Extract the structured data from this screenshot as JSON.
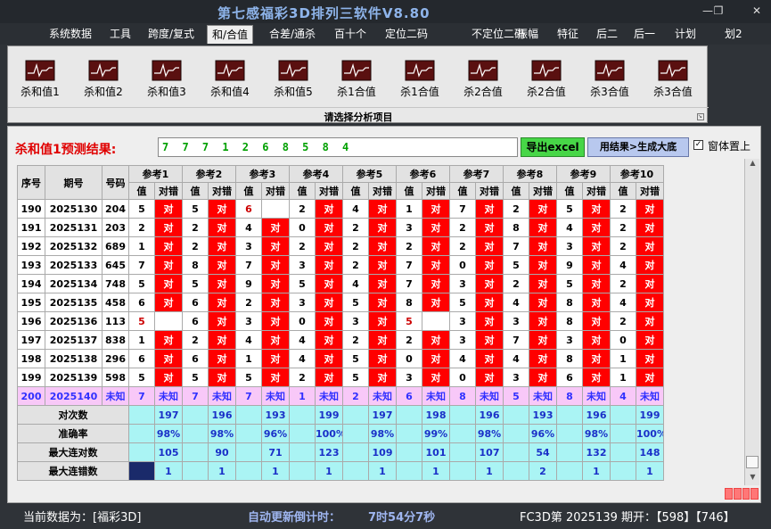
{
  "app": {
    "title": "第七感福彩3D排列三软件V8.80"
  },
  "menu": [
    "系统数据",
    "工具",
    "跨度/复式",
    "和/合值",
    "合差/通杀",
    "百十个",
    "定位二码",
    "不定位二码",
    "振幅",
    "特征",
    "后二",
    "后一",
    "计划",
    "划2"
  ],
  "menu_active": 3,
  "ribbon": {
    "buttons": [
      "杀和值1",
      "杀和值2",
      "杀和值3",
      "杀和值4",
      "杀和值5",
      "杀1合值",
      "杀1合值",
      "杀2合值",
      "杀2合值",
      "杀3合值",
      "杀3合值"
    ],
    "icon": "chart-icon",
    "caption": "请选择分析项目"
  },
  "prediction": {
    "label": "杀和值1预测结果:",
    "values": "7 7 7 1 2 6 8 5 8 4"
  },
  "buttons": {
    "export": "导出excel",
    "generate": "用结果>生成大底"
  },
  "checkbox": {
    "label": "窗体置上",
    "checked": "✓"
  },
  "table": {
    "headers": {
      "seq": "序号",
      "period": "期号",
      "number": "号码",
      "val": "值",
      "result": "对错"
    },
    "refs": [
      "参考1",
      "参考2",
      "参考3",
      "参考4",
      "参考5",
      "参考6",
      "参考7",
      "参考8",
      "参考9",
      "参考10"
    ],
    "rows": [
      {
        "seq": "190",
        "period": "2025130",
        "number": "204",
        "cells": [
          [
            "5",
            "对"
          ],
          [
            "5",
            "对"
          ],
          [
            "6",
            ""
          ],
          [
            "2",
            "对"
          ],
          [
            "4",
            "对"
          ],
          [
            "1",
            "对"
          ],
          [
            "7",
            "对"
          ],
          [
            "2",
            "对"
          ],
          [
            "5",
            "对"
          ],
          [
            "2",
            "对"
          ]
        ]
      },
      {
        "seq": "191",
        "period": "2025131",
        "number": "203",
        "cells": [
          [
            "2",
            "对"
          ],
          [
            "2",
            "对"
          ],
          [
            "4",
            "对"
          ],
          [
            "0",
            "对"
          ],
          [
            "2",
            "对"
          ],
          [
            "3",
            "对"
          ],
          [
            "2",
            "对"
          ],
          [
            "8",
            "对"
          ],
          [
            "4",
            "对"
          ],
          [
            "2",
            "对"
          ]
        ]
      },
      {
        "seq": "192",
        "period": "2025132",
        "number": "689",
        "cells": [
          [
            "1",
            "对"
          ],
          [
            "2",
            "对"
          ],
          [
            "3",
            "对"
          ],
          [
            "2",
            "对"
          ],
          [
            "2",
            "对"
          ],
          [
            "2",
            "对"
          ],
          [
            "2",
            "对"
          ],
          [
            "7",
            "对"
          ],
          [
            "3",
            "对"
          ],
          [
            "2",
            "对"
          ]
        ]
      },
      {
        "seq": "193",
        "period": "2025133",
        "number": "645",
        "cells": [
          [
            "7",
            "对"
          ],
          [
            "8",
            "对"
          ],
          [
            "7",
            "对"
          ],
          [
            "3",
            "对"
          ],
          [
            "2",
            "对"
          ],
          [
            "7",
            "对"
          ],
          [
            "0",
            "对"
          ],
          [
            "5",
            "对"
          ],
          [
            "9",
            "对"
          ],
          [
            "4",
            "对"
          ]
        ]
      },
      {
        "seq": "194",
        "period": "2025134",
        "number": "748",
        "cells": [
          [
            "5",
            "对"
          ],
          [
            "5",
            "对"
          ],
          [
            "9",
            "对"
          ],
          [
            "5",
            "对"
          ],
          [
            "4",
            "对"
          ],
          [
            "7",
            "对"
          ],
          [
            "3",
            "对"
          ],
          [
            "2",
            "对"
          ],
          [
            "5",
            "对"
          ],
          [
            "2",
            "对"
          ]
        ]
      },
      {
        "seq": "195",
        "period": "2025135",
        "number": "458",
        "cells": [
          [
            "6",
            "对"
          ],
          [
            "6",
            "对"
          ],
          [
            "2",
            "对"
          ],
          [
            "3",
            "对"
          ],
          [
            "5",
            "对"
          ],
          [
            "8",
            "对"
          ],
          [
            "5",
            "对"
          ],
          [
            "4",
            "对"
          ],
          [
            "8",
            "对"
          ],
          [
            "4",
            "对"
          ]
        ]
      },
      {
        "seq": "196",
        "period": "2025136",
        "number": "113",
        "cells": [
          [
            "5",
            ""
          ],
          [
            "6",
            "对"
          ],
          [
            "3",
            "对"
          ],
          [
            "0",
            "对"
          ],
          [
            "3",
            "对"
          ],
          [
            "5",
            ""
          ],
          [
            "3",
            "对"
          ],
          [
            "3",
            "对"
          ],
          [
            "8",
            "对"
          ],
          [
            "2",
            "对"
          ]
        ]
      },
      {
        "seq": "197",
        "period": "2025137",
        "number": "838",
        "cells": [
          [
            "1",
            "对"
          ],
          [
            "2",
            "对"
          ],
          [
            "4",
            "对"
          ],
          [
            "4",
            "对"
          ],
          [
            "2",
            "对"
          ],
          [
            "2",
            "对"
          ],
          [
            "3",
            "对"
          ],
          [
            "7",
            "对"
          ],
          [
            "3",
            "对"
          ],
          [
            "0",
            "对"
          ]
        ]
      },
      {
        "seq": "198",
        "period": "2025138",
        "number": "296",
        "cells": [
          [
            "6",
            "对"
          ],
          [
            "6",
            "对"
          ],
          [
            "1",
            "对"
          ],
          [
            "4",
            "对"
          ],
          [
            "5",
            "对"
          ],
          [
            "0",
            "对"
          ],
          [
            "4",
            "对"
          ],
          [
            "4",
            "对"
          ],
          [
            "8",
            "对"
          ],
          [
            "1",
            "对"
          ]
        ]
      },
      {
        "seq": "199",
        "period": "2025139",
        "number": "598",
        "cells": [
          [
            "5",
            "对"
          ],
          [
            "5",
            "对"
          ],
          [
            "5",
            "对"
          ],
          [
            "2",
            "对"
          ],
          [
            "5",
            "对"
          ],
          [
            "3",
            "对"
          ],
          [
            "0",
            "对"
          ],
          [
            "3",
            "对"
          ],
          [
            "6",
            "对"
          ],
          [
            "1",
            "对"
          ]
        ]
      },
      {
        "seq": "200",
        "period": "2025140",
        "number": "未知",
        "cells": [
          [
            "7",
            "未知"
          ],
          [
            "7",
            "未知"
          ],
          [
            "7",
            "未知"
          ],
          [
            "1",
            "未知"
          ],
          [
            "2",
            "未知"
          ],
          [
            "6",
            "未知"
          ],
          [
            "8",
            "未知"
          ],
          [
            "5",
            "未知"
          ],
          [
            "8",
            "未知"
          ],
          [
            "4",
            "未知"
          ]
        ]
      }
    ],
    "stats": [
      {
        "label": "对次数",
        "values": [
          "197",
          "196",
          "193",
          "199",
          "197",
          "198",
          "196",
          "193",
          "196",
          "199"
        ]
      },
      {
        "label": "准确率",
        "values": [
          "98%",
          "98%",
          "96%",
          "100%",
          "98%",
          "99%",
          "98%",
          "96%",
          "98%",
          "100%"
        ]
      },
      {
        "label": "最大连对数",
        "values": [
          "105",
          "90",
          "71",
          "123",
          "109",
          "101",
          "107",
          "54",
          "132",
          "148"
        ]
      },
      {
        "label": "最大连错数",
        "values": [
          "1",
          "1",
          "1",
          "1",
          "1",
          "1",
          "1",
          "2",
          "1",
          "1"
        ]
      }
    ]
  },
  "status": {
    "data_source": "当前数据为：[福彩3D]",
    "timer_label": "自动更新倒计时：",
    "timer_value": "7时54分7秒",
    "issue": "FC3D第 2025139 期开：【598】【746】"
  },
  "colors": {
    "hit": "#ff0000",
    "unknown": "#f8c8f8",
    "stats": "#aaf4f4",
    "export": "#47d647",
    "generate": "#b8c8ee"
  }
}
